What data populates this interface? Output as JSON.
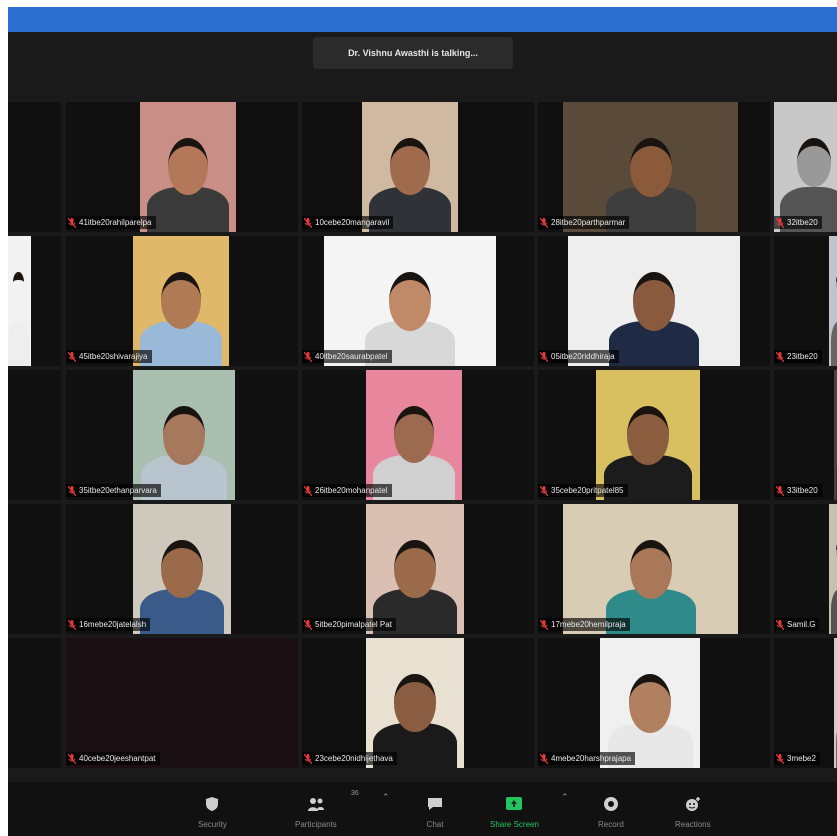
{
  "speaking_banner": "Dr. Vishnu Awasthi is talking...",
  "participants": [
    {
      "name": "41itbe20rahilparelpa",
      "bg": "#c98e86",
      "shirt": "#3a3a3a",
      "skin": "#b3785a"
    },
    {
      "name": "10cebe20mangaravil",
      "bg": "#cfb9a0",
      "shirt": "#2f3236",
      "skin": "#a06a4c"
    },
    {
      "name": "28itbe20parthparmar",
      "bg": "#5a4a3a",
      "shirt": "#3e3e3e",
      "skin": "#8a5a3a"
    },
    {
      "name": "32itbe20",
      "bg": "#c8c8c8",
      "shirt": "#555",
      "skin": "#999"
    },
    {
      "name": "",
      "bg": "#f2f2f2",
      "shirt": "#eeeeee",
      "skin": "#f2f2f2"
    },
    {
      "name": "45itbe20shivarajiya",
      "bg": "#e0b86a",
      "shirt": "#9ab8d8",
      "skin": "#b07a55"
    },
    {
      "name": "40itbe20saurabpatel",
      "bg": "#f4f4f4",
      "shirt": "#d8d8d8",
      "skin": "#c08a68"
    },
    {
      "name": "05itbe20riddhiraja",
      "bg": "#eeeeee",
      "shirt": "#1f2a44",
      "skin": "#8a5a3e"
    },
    {
      "name": "23itbe20",
      "bg": "#bfc5cc",
      "shirt": "#666",
      "skin": "#999"
    },
    {
      "name": "35itbe20ethanparvara",
      "bg": "#a9bfb0",
      "shirt": "#b8c4ce",
      "skin": "#a8785c"
    },
    {
      "name": "26itbe20mohanpatel",
      "bg": "#e8869e",
      "shirt": "#d0d0d0",
      "skin": "#9c6a4e"
    },
    {
      "name": "35cebe20pritpatel85",
      "bg": "#d8c060",
      "shirt": "#1c1c1c",
      "skin": "#8c5e40"
    },
    {
      "name": "33itbe20",
      "bg": "#444",
      "shirt": "#333",
      "skin": "#777"
    },
    {
      "name": "16mebe20jatelalsh",
      "bg": "#cfc9bd",
      "shirt": "#3a5a8a",
      "skin": "#9a6a4a"
    },
    {
      "name": "5itbe20pimalpatel Pat",
      "bg": "#d9c0b3",
      "shirt": "#2a2a2a",
      "skin": "#9a6a4a"
    },
    {
      "name": "17mebe20hemilpraja",
      "bg": "#d8ccb4",
      "shirt": "#2f8a8a",
      "skin": "#a87858"
    },
    {
      "name": "Samil.G",
      "bg": "#c8c0b0",
      "shirt": "#555",
      "skin": "#999"
    },
    {
      "name": "40cebe20jeeshantpat",
      "bg": "#1a1014",
      "shirt": "#1a1014",
      "skin": "#1a1014"
    },
    {
      "name": "23cebe20nidhijethava",
      "bg": "#e8e0d0",
      "shirt": "#1a1a1a",
      "skin": "#8a5c42"
    },
    {
      "name": "4mebe20harshprajapa",
      "bg": "#f0f0f0",
      "shirt": "#e8e8e8",
      "skin": "#b08060"
    },
    {
      "name": "3mebe2",
      "bg": "#cccccc",
      "shirt": "#666",
      "skin": "#999"
    }
  ],
  "toolbar": {
    "security": "Security",
    "participants": "Participants",
    "participant_count": "36",
    "chat": "Chat",
    "share_screen": "Share Screen",
    "record": "Record",
    "reactions": "Reactions",
    "share_color": "#22c55e"
  }
}
